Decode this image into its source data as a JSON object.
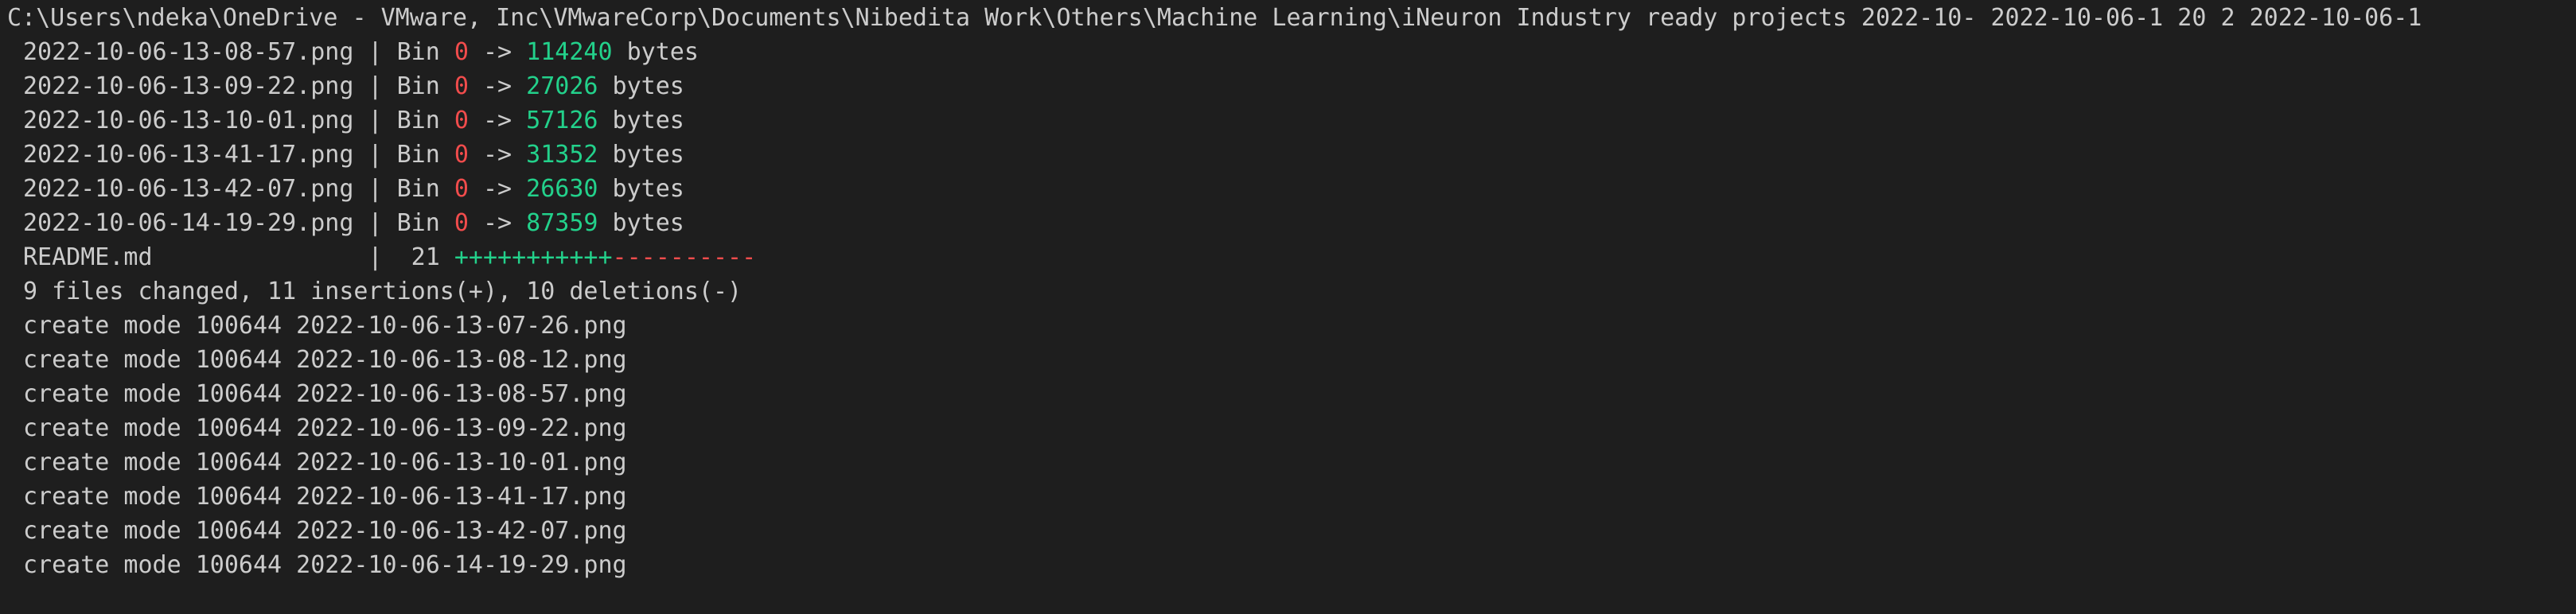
{
  "colors": {
    "background": "#1e1e1e",
    "foreground": "#cccccc",
    "removed": "#f14c4c",
    "added": "#23d18b"
  },
  "terminal": {
    "path_line": "C:\\Users\\ndeka\\OneDrive - VMware, Inc\\VMwareCorp\\Documents\\Nibedita Work\\Others\\Machine Learning\\iNeuron Industry ready projects 2022-10- 2022-10-06-1 20 2 2022-10-06-1",
    "bin_lines": [
      {
        "file": "2022-10-06-13-08-57.png",
        "sep": " | Bin ",
        "old": "0",
        "arrow": " -> ",
        "new": "114240",
        "unit": " bytes"
      },
      {
        "file": "2022-10-06-13-09-22.png",
        "sep": " | Bin ",
        "old": "0",
        "arrow": " -> ",
        "new": "27026",
        "unit": " bytes"
      },
      {
        "file": "2022-10-06-13-10-01.png",
        "sep": " | Bin ",
        "old": "0",
        "arrow": " -> ",
        "new": "57126",
        "unit": " bytes"
      },
      {
        "file": "2022-10-06-13-41-17.png",
        "sep": " | Bin ",
        "old": "0",
        "arrow": " -> ",
        "new": "31352",
        "unit": " bytes"
      },
      {
        "file": "2022-10-06-13-42-07.png",
        "sep": " | Bin ",
        "old": "0",
        "arrow": " -> ",
        "new": "26630",
        "unit": " bytes"
      },
      {
        "file": "2022-10-06-14-19-29.png",
        "sep": " | Bin ",
        "old": "0",
        "arrow": " -> ",
        "new": "87359",
        "unit": " bytes"
      }
    ],
    "readme_line": {
      "file": "README.md",
      "sep": "               |  21 ",
      "plus": "+++++++++++",
      "minus": "----------"
    },
    "summary": "9 files changed, 11 insertions(+), 10 deletions(-)",
    "create_lines": [
      "create mode 100644 2022-10-06-13-07-26.png",
      "create mode 100644 2022-10-06-13-08-12.png",
      "create mode 100644 2022-10-06-13-08-57.png",
      "create mode 100644 2022-10-06-13-09-22.png",
      "create mode 100644 2022-10-06-13-10-01.png",
      "create mode 100644 2022-10-06-13-41-17.png",
      "create mode 100644 2022-10-06-13-42-07.png",
      "create mode 100644 2022-10-06-14-19-29.png"
    ]
  }
}
